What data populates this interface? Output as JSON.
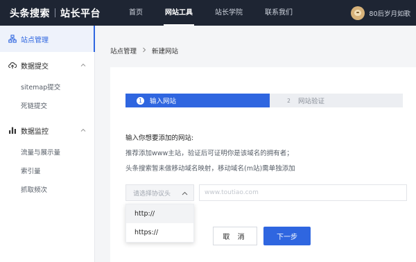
{
  "header": {
    "brand": "头条搜索",
    "brand_sub": "站长平台",
    "nav": [
      "首页",
      "网站工具",
      "站长学院",
      "联系我们"
    ],
    "active_nav": "网站工具",
    "user_name": "80后岁月如歌"
  },
  "sidebar": {
    "site_manage": "站点管理",
    "data_submit": "数据提交",
    "sitemap": "sitemap提交",
    "dead_link": "死链提交",
    "data_monitor": "数据监控",
    "traffic": "流量与展示量",
    "index": "索引量",
    "crawl": "抓取频次"
  },
  "breadcrumb": {
    "parent": "站点管理",
    "current": "新建网站"
  },
  "steps": [
    {
      "num": "1",
      "label": "输入网站"
    },
    {
      "num": "2",
      "label": "网站验证"
    }
  ],
  "form": {
    "label": "输入你想要添加的网站:",
    "hint1": "推荐添加www主站，验证后可证明你是该域名的拥有者；",
    "hint2": "头条搜索暂未做移动域名映射，移动域名(m站)需单独添加",
    "protocol_placeholder": "请选择协议头",
    "url_placeholder": "www.toutiao.com",
    "protocol_options": [
      "http://",
      "https://"
    ]
  },
  "buttons": {
    "cancel": "取 消",
    "next": "下一步"
  },
  "colors": {
    "topbar": "#1e2533",
    "accent": "#2f66e0"
  }
}
